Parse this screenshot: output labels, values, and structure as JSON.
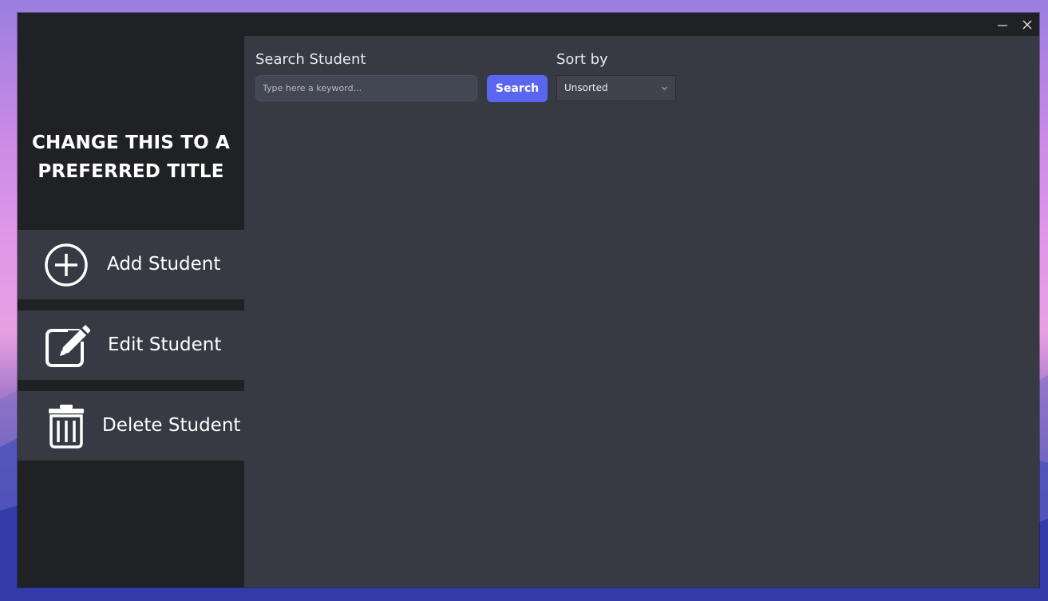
{
  "window": {
    "controls": {
      "minimize_icon": "minimize-icon",
      "close_icon": "close-icon"
    }
  },
  "sidebar": {
    "title_line1": "CHANGE THIS TO A",
    "title_line2": "PREFERRED TITLE",
    "items": [
      {
        "label": "Add Student",
        "icon": "plus-circle-icon"
      },
      {
        "label": "Edit Student",
        "icon": "edit-icon"
      },
      {
        "label": "Delete Student",
        "icon": "trash-icon"
      }
    ]
  },
  "main": {
    "search": {
      "label": "Search Student",
      "placeholder": "Type here a keyword...",
      "value": "",
      "button_label": "Search"
    },
    "sort": {
      "label": "Sort by",
      "selected": "Unsorted"
    }
  },
  "colors": {
    "sidebar_bg": "#202125",
    "panel_bg": "#373a43",
    "accent": "#5a66f0",
    "text": "#ffffff"
  }
}
